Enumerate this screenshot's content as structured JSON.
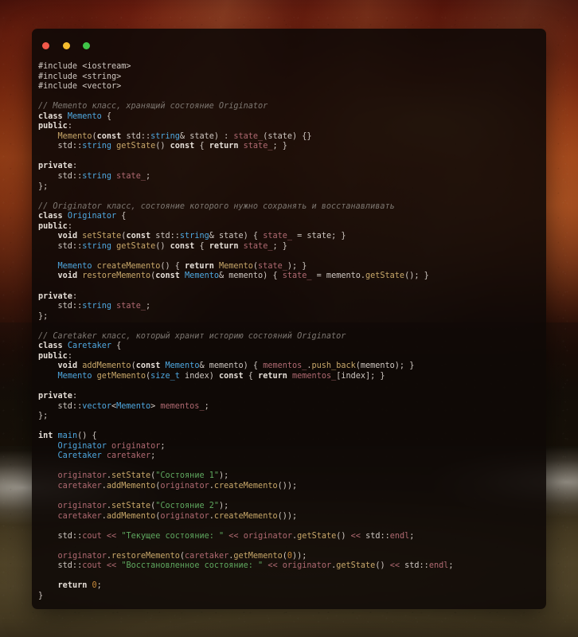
{
  "window": {
    "traffic_lights": [
      {
        "name": "close",
        "color": "#f2584a"
      },
      {
        "name": "minimize",
        "color": "#f5bc2e"
      },
      {
        "name": "maximize",
        "color": "#3fc549"
      }
    ]
  },
  "editor": {
    "language": "C++",
    "theme_background": "#0e0907",
    "colors": {
      "preprocessor": "#cfc8c2",
      "comment": "#7d7771",
      "keyword": "#e6dfd8",
      "type": "#4fa8e0",
      "function": "#c9a86a",
      "string": "#5fa85f",
      "number": "#c98a3a",
      "variable": "#b06a72",
      "plain": "#cfc8c2"
    },
    "lines": [
      [
        {
          "t": "pre",
          "s": "#include <iostream>"
        }
      ],
      [
        {
          "t": "pre",
          "s": "#include <string>"
        }
      ],
      [
        {
          "t": "pre",
          "s": "#include <vector>"
        }
      ],
      [],
      [
        {
          "t": "cmt",
          "s": "// Memento класс, хранящий состояние Originator"
        }
      ],
      [
        {
          "t": "kw",
          "s": "class "
        },
        {
          "t": "type",
          "s": "Memento"
        },
        {
          "t": "plain",
          "s": " {"
        }
      ],
      [
        {
          "t": "kw",
          "s": "public"
        },
        {
          "t": "plain",
          "s": ":"
        }
      ],
      [
        {
          "t": "plain",
          "s": "    "
        },
        {
          "t": "fn",
          "s": "Memento"
        },
        {
          "t": "plain",
          "s": "("
        },
        {
          "t": "kw",
          "s": "const "
        },
        {
          "t": "plain",
          "s": "std::"
        },
        {
          "t": "type",
          "s": "string"
        },
        {
          "t": "plain",
          "s": "& state) : "
        },
        {
          "t": "var",
          "s": "state_"
        },
        {
          "t": "plain",
          "s": "(state) {}"
        }
      ],
      [
        {
          "t": "plain",
          "s": "    std::"
        },
        {
          "t": "type",
          "s": "string"
        },
        {
          "t": "plain",
          "s": " "
        },
        {
          "t": "fn",
          "s": "getState"
        },
        {
          "t": "plain",
          "s": "() "
        },
        {
          "t": "kw",
          "s": "const"
        },
        {
          "t": "plain",
          "s": " { "
        },
        {
          "t": "kw",
          "s": "return "
        },
        {
          "t": "var",
          "s": "state_"
        },
        {
          "t": "plain",
          "s": "; }"
        }
      ],
      [],
      [
        {
          "t": "kw",
          "s": "private"
        },
        {
          "t": "plain",
          "s": ":"
        }
      ],
      [
        {
          "t": "plain",
          "s": "    std::"
        },
        {
          "t": "type",
          "s": "string"
        },
        {
          "t": "plain",
          "s": " "
        },
        {
          "t": "var",
          "s": "state_"
        },
        {
          "t": "plain",
          "s": ";"
        }
      ],
      [
        {
          "t": "plain",
          "s": "};"
        }
      ],
      [],
      [
        {
          "t": "cmt",
          "s": "// Originator класс, состояние которого нужно сохранять и восстанавливать"
        }
      ],
      [
        {
          "t": "kw",
          "s": "class "
        },
        {
          "t": "type",
          "s": "Originator"
        },
        {
          "t": "plain",
          "s": " {"
        }
      ],
      [
        {
          "t": "kw",
          "s": "public"
        },
        {
          "t": "plain",
          "s": ":"
        }
      ],
      [
        {
          "t": "plain",
          "s": "    "
        },
        {
          "t": "kw",
          "s": "void "
        },
        {
          "t": "fn",
          "s": "setState"
        },
        {
          "t": "plain",
          "s": "("
        },
        {
          "t": "kw",
          "s": "const "
        },
        {
          "t": "plain",
          "s": "std::"
        },
        {
          "t": "type",
          "s": "string"
        },
        {
          "t": "plain",
          "s": "& state) { "
        },
        {
          "t": "var",
          "s": "state_"
        },
        {
          "t": "plain",
          "s": " = state; }"
        }
      ],
      [
        {
          "t": "plain",
          "s": "    std::"
        },
        {
          "t": "type",
          "s": "string"
        },
        {
          "t": "plain",
          "s": " "
        },
        {
          "t": "fn",
          "s": "getState"
        },
        {
          "t": "plain",
          "s": "() "
        },
        {
          "t": "kw",
          "s": "const"
        },
        {
          "t": "plain",
          "s": " { "
        },
        {
          "t": "kw",
          "s": "return "
        },
        {
          "t": "var",
          "s": "state_"
        },
        {
          "t": "plain",
          "s": "; }"
        }
      ],
      [],
      [
        {
          "t": "plain",
          "s": "    "
        },
        {
          "t": "type",
          "s": "Memento"
        },
        {
          "t": "plain",
          "s": " "
        },
        {
          "t": "fn",
          "s": "createMemento"
        },
        {
          "t": "plain",
          "s": "() { "
        },
        {
          "t": "kw",
          "s": "return "
        },
        {
          "t": "fn",
          "s": "Memento"
        },
        {
          "t": "plain",
          "s": "("
        },
        {
          "t": "var",
          "s": "state_"
        },
        {
          "t": "plain",
          "s": "); }"
        }
      ],
      [
        {
          "t": "plain",
          "s": "    "
        },
        {
          "t": "kw",
          "s": "void "
        },
        {
          "t": "fn",
          "s": "restoreMemento"
        },
        {
          "t": "plain",
          "s": "("
        },
        {
          "t": "kw",
          "s": "const "
        },
        {
          "t": "type",
          "s": "Memento"
        },
        {
          "t": "plain",
          "s": "& memento) { "
        },
        {
          "t": "var",
          "s": "state_"
        },
        {
          "t": "plain",
          "s": " = memento."
        },
        {
          "t": "fn",
          "s": "getState"
        },
        {
          "t": "plain",
          "s": "(); }"
        }
      ],
      [],
      [
        {
          "t": "kw",
          "s": "private"
        },
        {
          "t": "plain",
          "s": ":"
        }
      ],
      [
        {
          "t": "plain",
          "s": "    std::"
        },
        {
          "t": "type",
          "s": "string"
        },
        {
          "t": "plain",
          "s": " "
        },
        {
          "t": "var",
          "s": "state_"
        },
        {
          "t": "plain",
          "s": ";"
        }
      ],
      [
        {
          "t": "plain",
          "s": "};"
        }
      ],
      [],
      [
        {
          "t": "cmt",
          "s": "// Caretaker класс, который хранит историю состояний Originator"
        }
      ],
      [
        {
          "t": "kw",
          "s": "class "
        },
        {
          "t": "type",
          "s": "Caretaker"
        },
        {
          "t": "plain",
          "s": " {"
        }
      ],
      [
        {
          "t": "kw",
          "s": "public"
        },
        {
          "t": "plain",
          "s": ":"
        }
      ],
      [
        {
          "t": "plain",
          "s": "    "
        },
        {
          "t": "kw",
          "s": "void "
        },
        {
          "t": "fn",
          "s": "addMemento"
        },
        {
          "t": "plain",
          "s": "("
        },
        {
          "t": "kw",
          "s": "const "
        },
        {
          "t": "type",
          "s": "Memento"
        },
        {
          "t": "plain",
          "s": "& memento) { "
        },
        {
          "t": "var",
          "s": "mementos_"
        },
        {
          "t": "plain",
          "s": "."
        },
        {
          "t": "fn",
          "s": "push_back"
        },
        {
          "t": "plain",
          "s": "(memento); }"
        }
      ],
      [
        {
          "t": "plain",
          "s": "    "
        },
        {
          "t": "type",
          "s": "Memento"
        },
        {
          "t": "plain",
          "s": " "
        },
        {
          "t": "fn",
          "s": "getMemento"
        },
        {
          "t": "plain",
          "s": "("
        },
        {
          "t": "type",
          "s": "size_t"
        },
        {
          "t": "plain",
          "s": " index) "
        },
        {
          "t": "kw",
          "s": "const"
        },
        {
          "t": "plain",
          "s": " { "
        },
        {
          "t": "kw",
          "s": "return "
        },
        {
          "t": "var",
          "s": "mementos_"
        },
        {
          "t": "plain",
          "s": "[index]; }"
        }
      ],
      [],
      [
        {
          "t": "kw",
          "s": "private"
        },
        {
          "t": "plain",
          "s": ":"
        }
      ],
      [
        {
          "t": "plain",
          "s": "    std::"
        },
        {
          "t": "type",
          "s": "vector"
        },
        {
          "t": "plain",
          "s": "<"
        },
        {
          "t": "type",
          "s": "Memento"
        },
        {
          "t": "plain",
          "s": "> "
        },
        {
          "t": "var",
          "s": "mementos_"
        },
        {
          "t": "plain",
          "s": ";"
        }
      ],
      [
        {
          "t": "plain",
          "s": "};"
        }
      ],
      [],
      [
        {
          "t": "kw",
          "s": "int "
        },
        {
          "t": "type",
          "s": "main"
        },
        {
          "t": "plain",
          "s": "() {"
        }
      ],
      [
        {
          "t": "plain",
          "s": "    "
        },
        {
          "t": "type",
          "s": "Originator"
        },
        {
          "t": "plain",
          "s": " "
        },
        {
          "t": "var",
          "s": "originator"
        },
        {
          "t": "plain",
          "s": ";"
        }
      ],
      [
        {
          "t": "plain",
          "s": "    "
        },
        {
          "t": "type",
          "s": "Caretaker"
        },
        {
          "t": "plain",
          "s": " "
        },
        {
          "t": "var",
          "s": "caretaker"
        },
        {
          "t": "plain",
          "s": ";"
        }
      ],
      [],
      [
        {
          "t": "plain",
          "s": "    "
        },
        {
          "t": "var",
          "s": "originator"
        },
        {
          "t": "plain",
          "s": "."
        },
        {
          "t": "fn",
          "s": "setState"
        },
        {
          "t": "plain",
          "s": "("
        },
        {
          "t": "str",
          "s": "\"Состояние 1\""
        },
        {
          "t": "plain",
          "s": ");"
        }
      ],
      [
        {
          "t": "plain",
          "s": "    "
        },
        {
          "t": "var",
          "s": "caretaker"
        },
        {
          "t": "plain",
          "s": "."
        },
        {
          "t": "fn",
          "s": "addMemento"
        },
        {
          "t": "plain",
          "s": "("
        },
        {
          "t": "var",
          "s": "originator"
        },
        {
          "t": "plain",
          "s": "."
        },
        {
          "t": "fn",
          "s": "createMemento"
        },
        {
          "t": "plain",
          "s": "());"
        }
      ],
      [],
      [
        {
          "t": "plain",
          "s": "    "
        },
        {
          "t": "var",
          "s": "originator"
        },
        {
          "t": "plain",
          "s": "."
        },
        {
          "t": "fn",
          "s": "setState"
        },
        {
          "t": "plain",
          "s": "("
        },
        {
          "t": "str",
          "s": "\"Состояние 2\""
        },
        {
          "t": "plain",
          "s": ");"
        }
      ],
      [
        {
          "t": "plain",
          "s": "    "
        },
        {
          "t": "var",
          "s": "caretaker"
        },
        {
          "t": "plain",
          "s": "."
        },
        {
          "t": "fn",
          "s": "addMemento"
        },
        {
          "t": "plain",
          "s": "("
        },
        {
          "t": "var",
          "s": "originator"
        },
        {
          "t": "plain",
          "s": "."
        },
        {
          "t": "fn",
          "s": "createMemento"
        },
        {
          "t": "plain",
          "s": "());"
        }
      ],
      [],
      [
        {
          "t": "plain",
          "s": "    std::"
        },
        {
          "t": "var",
          "s": "cout"
        },
        {
          "t": "plain",
          "s": " "
        },
        {
          "t": "op",
          "s": "<<"
        },
        {
          "t": "plain",
          "s": " "
        },
        {
          "t": "str",
          "s": "\"Текущее состояние: \""
        },
        {
          "t": "plain",
          "s": " "
        },
        {
          "t": "op",
          "s": "<<"
        },
        {
          "t": "plain",
          "s": " "
        },
        {
          "t": "var",
          "s": "originator"
        },
        {
          "t": "plain",
          "s": "."
        },
        {
          "t": "fn",
          "s": "getState"
        },
        {
          "t": "plain",
          "s": "() "
        },
        {
          "t": "op",
          "s": "<<"
        },
        {
          "t": "plain",
          "s": " std::"
        },
        {
          "t": "var",
          "s": "endl"
        },
        {
          "t": "plain",
          "s": ";"
        }
      ],
      [],
      [
        {
          "t": "plain",
          "s": "    "
        },
        {
          "t": "var",
          "s": "originator"
        },
        {
          "t": "plain",
          "s": "."
        },
        {
          "t": "fn",
          "s": "restoreMemento"
        },
        {
          "t": "plain",
          "s": "("
        },
        {
          "t": "var",
          "s": "caretaker"
        },
        {
          "t": "plain",
          "s": "."
        },
        {
          "t": "fn",
          "s": "getMemento"
        },
        {
          "t": "plain",
          "s": "("
        },
        {
          "t": "num",
          "s": "0"
        },
        {
          "t": "plain",
          "s": "));"
        }
      ],
      [
        {
          "t": "plain",
          "s": "    std::"
        },
        {
          "t": "var",
          "s": "cout"
        },
        {
          "t": "plain",
          "s": " "
        },
        {
          "t": "op",
          "s": "<<"
        },
        {
          "t": "plain",
          "s": " "
        },
        {
          "t": "str",
          "s": "\"Восстановленное состояние: \""
        },
        {
          "t": "plain",
          "s": " "
        },
        {
          "t": "op",
          "s": "<<"
        },
        {
          "t": "plain",
          "s": " "
        },
        {
          "t": "var",
          "s": "originator"
        },
        {
          "t": "plain",
          "s": "."
        },
        {
          "t": "fn",
          "s": "getState"
        },
        {
          "t": "plain",
          "s": "() "
        },
        {
          "t": "op",
          "s": "<<"
        },
        {
          "t": "plain",
          "s": " std::"
        },
        {
          "t": "var",
          "s": "endl"
        },
        {
          "t": "plain",
          "s": ";"
        }
      ],
      [],
      [
        {
          "t": "plain",
          "s": "    "
        },
        {
          "t": "kw",
          "s": "return "
        },
        {
          "t": "num",
          "s": "0"
        },
        {
          "t": "plain",
          "s": ";"
        }
      ],
      [
        {
          "t": "plain",
          "s": "}"
        }
      ]
    ]
  }
}
